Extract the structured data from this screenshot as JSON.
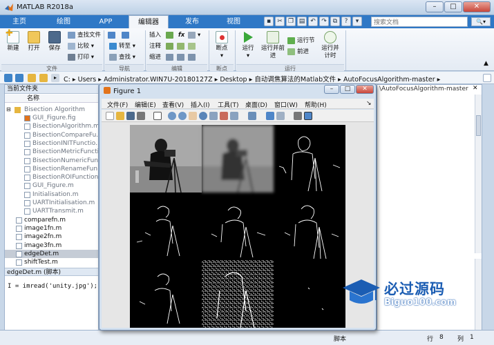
{
  "window": {
    "title": "MATLAB R2018a",
    "minimize": "–",
    "maximize": "□",
    "close": "✕"
  },
  "tabs": [
    {
      "label": "主页"
    },
    {
      "label": "绘图"
    },
    {
      "label": "APP"
    },
    {
      "label": "编辑器",
      "active": true
    },
    {
      "label": "发布"
    },
    {
      "label": "视图"
    }
  ],
  "search": {
    "placeholder": "搜索文档"
  },
  "ribbon": {
    "file": {
      "new": "新建",
      "open": "打开",
      "save": "保存",
      "find_files": "查找文件",
      "compare": "比较",
      "print": "打印",
      "group": "文件"
    },
    "navigate": {
      "goto": "转至",
      "find": "查找",
      "group": "导航"
    },
    "edit": {
      "insert": "插入",
      "fx": "fx",
      "comment": "注释",
      "indent": "缩进",
      "group": "编辑"
    },
    "breakpoints": {
      "label": "断点",
      "group": "断点"
    },
    "run": {
      "run": "运行",
      "run_advance": "运行并前进",
      "run_section": "运行节",
      "advance": "前进",
      "run_time": "运行并计时",
      "group": "运行"
    }
  },
  "address": {
    "segments": [
      "C:",
      "Users",
      "Administrator.WIN7U-20180127Z",
      "Desktop",
      "自动调焦算法的Matlab文件",
      "AutoFocusAlgorithm-master"
    ]
  },
  "current_folder": {
    "title": "当前文件夹",
    "column": "名称",
    "folder": "Bisection Algorithm",
    "files": [
      {
        "name": "GUI_Figure.fig",
        "grey": true
      },
      {
        "name": "BisectionAlgorithm.m",
        "grey": true
      },
      {
        "name": "BisectionCompareFu...",
        "grey": true
      },
      {
        "name": "BisectionINITFunctio...",
        "grey": true
      },
      {
        "name": "BisectionMetricFuncti...",
        "grey": true
      },
      {
        "name": "BisectionNumericFun...",
        "grey": true
      },
      {
        "name": "BisectionRenameFun...",
        "grey": true
      },
      {
        "name": "BisectionROIFunction...",
        "grey": true
      },
      {
        "name": "GUI_Figure.m",
        "grey": true
      },
      {
        "name": "Initialisation.m",
        "grey": true
      },
      {
        "name": "UARTInitialisation.m",
        "grey": true
      },
      {
        "name": "UARTTransmit.m",
        "grey": true
      },
      {
        "name": "comparefn.m",
        "grey": false
      },
      {
        "name": "image1fn.m",
        "grey": false
      },
      {
        "name": "image2fn.m",
        "grey": false
      },
      {
        "name": "image3fn.m",
        "grey": false
      },
      {
        "name": "edgeDet.m",
        "grey": false,
        "selected": true
      },
      {
        "name": "shiftTest.m",
        "grey": false
      }
    ],
    "details_title": "edgeDet.m (脚本)",
    "code_line": "I = imread('unity.jpg');"
  },
  "editor_tab": {
    "label": "\\AutoFocusAlgorithm-master"
  },
  "status": {
    "script": "脚本",
    "row_label": "行",
    "row": "8",
    "col_label": "列",
    "col": "1"
  },
  "figure": {
    "title": "Figure 1",
    "menu": [
      "文件(F)",
      "编辑(E)",
      "查看(V)",
      "插入(I)",
      "工具(T)",
      "桌面(D)",
      "窗口(W)",
      "帮助(H)"
    ]
  },
  "watermark": {
    "line1": "必过源码",
    "line2": "Biguo100.com"
  },
  "colors": {
    "tab_bar": "#2f78c6",
    "watermark_blue": "#1b5db3",
    "run_green": "#3aa83a"
  }
}
